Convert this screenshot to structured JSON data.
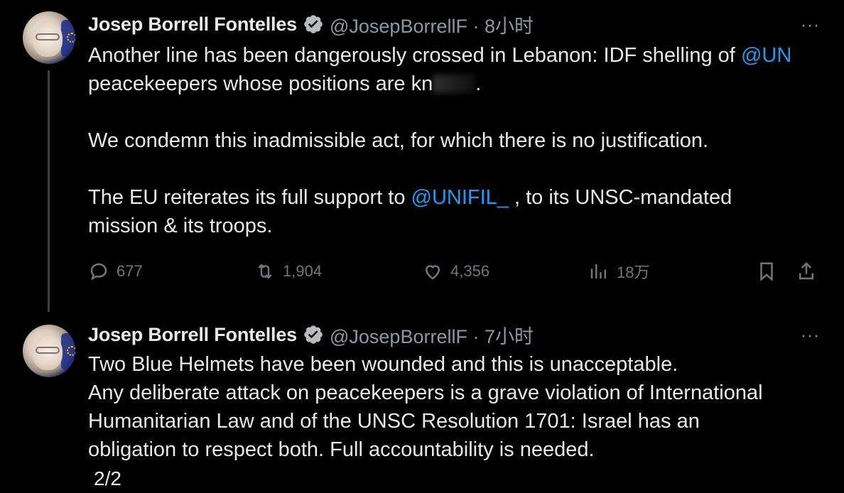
{
  "tweets": [
    {
      "author": "Josep Borrell Fontelles",
      "handle": "@JosepBorrellF · 8小时",
      "more": "···",
      "lines": [
        [
          "Another line has been dangerously crossed in Lebanon: IDF shelling of ",
          "@UN"
        ],
        [
          "peacekeepers whose positions are kn",
          "."
        ],
        [
          "We condemn this inadmissible act, for which there is no justification."
        ],
        [
          "The EU reiterates its full support to ",
          "@UNIFIL_",
          " , to its UNSC-mandated"
        ],
        [
          "mission & its troops."
        ]
      ],
      "stats": {
        "replies": "677",
        "retweets": "1,904",
        "likes": "4,356",
        "views": "18万"
      }
    },
    {
      "author": "Josep Borrell Fontelles",
      "handle": "@JosepBorrellF · 7小时",
      "more": "···",
      "lines": [
        [
          "Two Blue Helmets have been wounded and this is unacceptable."
        ],
        [
          "Any deliberate attack on peacekeepers is a grave violation of International"
        ],
        [
          "Humanitarian Law and of the UNSC Resolution 1701: Israel has an"
        ],
        [
          "obligation to respect both. Full accountability is needed."
        ]
      ],
      "page": "2/2"
    }
  ],
  "colors": {
    "background": "#000000",
    "text": "#e7e9ea",
    "muted": "#8b98a5",
    "accent": "#1d9bf0",
    "thread_line": "#3b3f45"
  },
  "icons": [
    "reply-icon",
    "retweet-icon",
    "like-icon",
    "views-icon",
    "bookmark-icon",
    "share-icon",
    "verified-badge-icon",
    "more-icon"
  ]
}
